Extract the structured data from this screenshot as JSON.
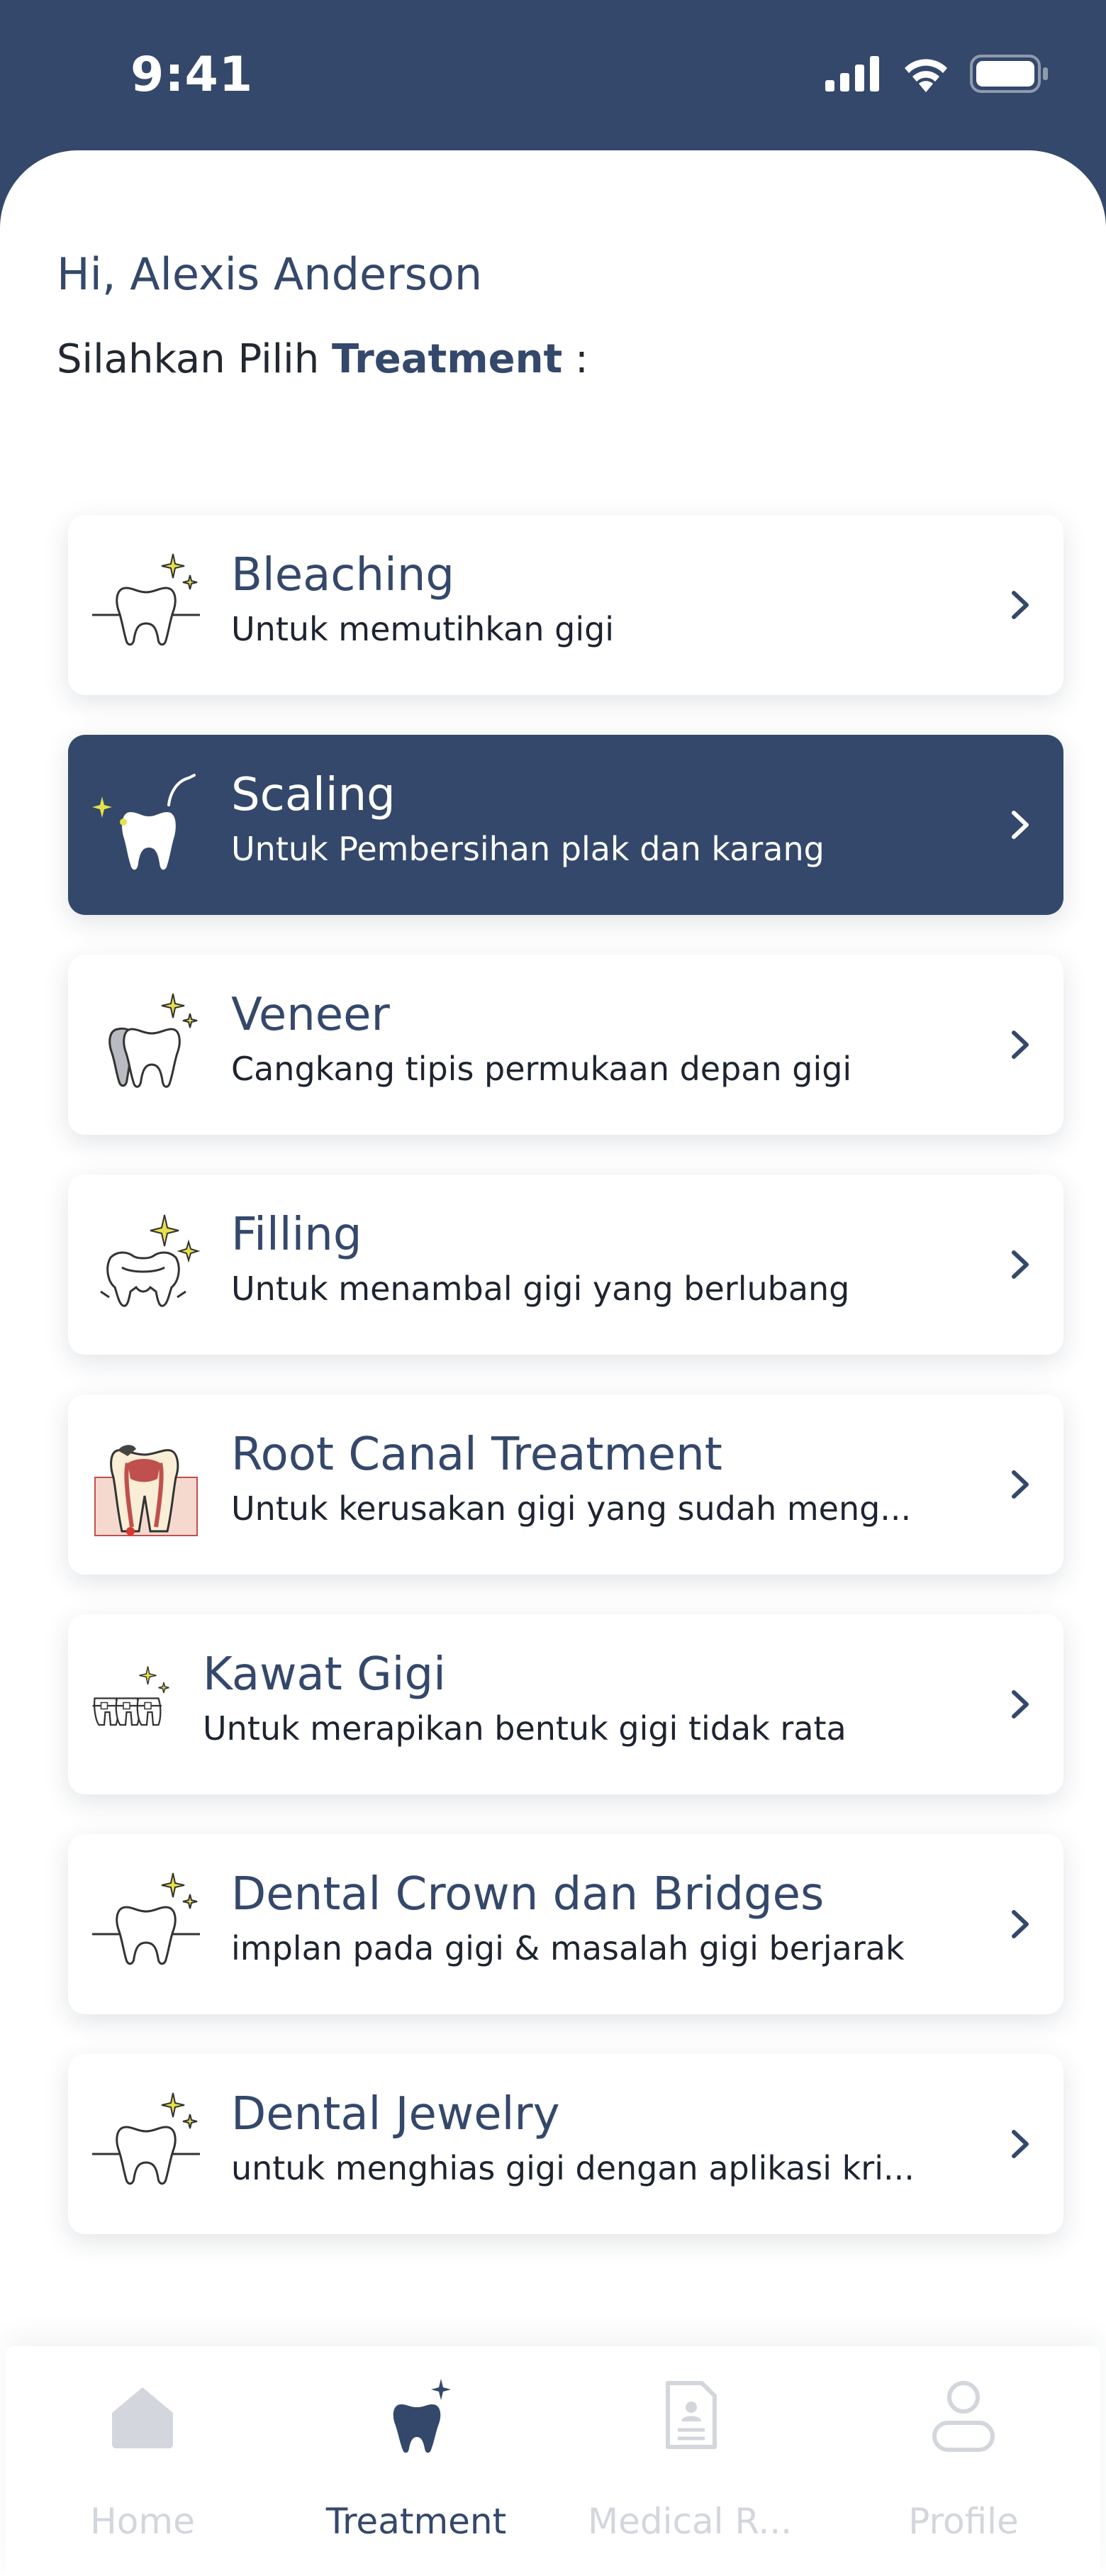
{
  "status_bar": {
    "time": "9:41"
  },
  "greeting": "Hi, Alexis Anderson",
  "prompt": {
    "prefix": "Silahkan Pilih ",
    "bold": "Treatment",
    "suffix": " :"
  },
  "treatments": [
    {
      "title": "Bleaching",
      "subtitle": "Untuk memutihkan gigi",
      "icon": "tooth-sparkle-icon",
      "active": false
    },
    {
      "title": "Scaling",
      "subtitle": "Untuk Pembersihan plak dan karang",
      "icon": "tooth-scaler-icon",
      "active": true
    },
    {
      "title": "Veneer",
      "subtitle": "Cangkang tipis permukaan depan gigi",
      "icon": "veneer-tooth-icon",
      "active": false
    },
    {
      "title": "Filling",
      "subtitle": "Untuk menambal gigi yang berlubang",
      "icon": "molar-filling-icon",
      "active": false
    },
    {
      "title": "Root Canal Treatment",
      "subtitle": "Untuk kerusakan gigi yang sudah meng...",
      "icon": "root-canal-icon",
      "active": false
    },
    {
      "title": "Kawat Gigi",
      "subtitle": "Untuk merapikan bentuk gigi tidak rata",
      "icon": "braces-icon",
      "active": false
    },
    {
      "title": "Dental Crown dan Bridges",
      "subtitle": "implan pada gigi & masalah gigi berjarak",
      "icon": "tooth-sparkle-icon",
      "active": false
    },
    {
      "title": "Dental Jewelry",
      "subtitle": "untuk menghias gigi dengan aplikasi kri...",
      "icon": "tooth-sparkle-icon",
      "active": false
    }
  ],
  "nav": {
    "home": "Home",
    "treatment": "Treatment",
    "medical": "Medical R...",
    "profile": "Profile",
    "active": "treatment"
  },
  "colors": {
    "primary": "#34486b",
    "sparkle": "#e8e04a",
    "inactive": "#d3d6dc"
  }
}
